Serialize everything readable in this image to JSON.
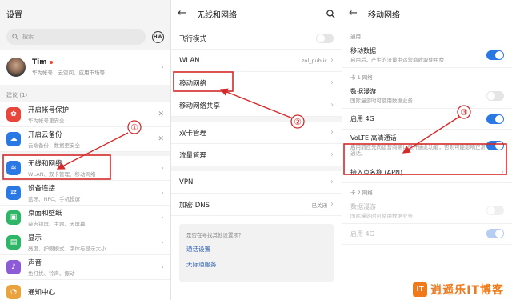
{
  "left": {
    "title": "设置",
    "search_placeholder": "搜索",
    "brand_icon": "HW",
    "account": {
      "name": "Tim",
      "sub": "华为帐号、云空间、应用市场等"
    },
    "suggest_label": "建议 (1)",
    "suggestions": [
      {
        "title": "开启帐号保护",
        "sub": "华为帐号更安全",
        "icon": "account-protect-icon",
        "color": "#e8453c"
      },
      {
        "title": "开启云备份",
        "sub": "云端备份，数据更安全",
        "icon": "cloud-backup-icon",
        "color": "#2a78e4"
      }
    ],
    "items": [
      {
        "title": "无线和网络",
        "sub": "WLAN、双卡管理、移动网络",
        "icon": "wifi-icon",
        "color": "#2a78e4"
      },
      {
        "title": "设备连接",
        "sub": "蓝牙、NFC、手机投屏",
        "icon": "device-link-icon",
        "color": "#2a78e4"
      },
      {
        "title": "桌面和壁纸",
        "sub": "杂志锁屏、主题、天屏幕",
        "icon": "wallpaper-icon",
        "color": "#2fb566"
      },
      {
        "title": "显示",
        "sub": "亮度、护眼模式、字体与显示大小",
        "icon": "display-icon",
        "color": "#2fb566"
      },
      {
        "title": "声音",
        "sub": "免打扰、铃声、振动",
        "icon": "sound-icon",
        "color": "#8e5bd6"
      },
      {
        "title": "通知中心",
        "sub": "",
        "icon": "notify-icon",
        "color": "#e8a33c"
      }
    ]
  },
  "middle": {
    "title": "无线和网络",
    "rows": [
      {
        "label": "飞行模式",
        "value": "",
        "control": "toggle-off"
      },
      {
        "label": "WLAN",
        "value": "zol_public",
        "control": "chevron"
      },
      {
        "label": "移动网络",
        "value": "",
        "control": "chevron"
      },
      {
        "label": "移动网络共享",
        "value": "",
        "control": "chevron"
      },
      {
        "label": "双卡管理",
        "value": "",
        "control": "chevron"
      },
      {
        "label": "流量管理",
        "value": "",
        "control": "chevron"
      },
      {
        "label": "VPN",
        "value": "",
        "control": "chevron"
      },
      {
        "label": "加密 DNS",
        "value": "已关闭",
        "control": "chevron"
      }
    ],
    "suggest_q": "是否在寻找其他设置项？",
    "links": [
      "通话设置",
      "天际通服务"
    ]
  },
  "right": {
    "title": "移动网络",
    "group_general": "通用",
    "mobile_data": {
      "title": "移动数据",
      "sub": "启用后，产生的流量由运营商收取使用费"
    },
    "group_sim1": "卡 1 网络",
    "roaming": {
      "title": "数据漫游",
      "sub": "国际漫游时可使用数据业务"
    },
    "lte4g": {
      "title": "启用 4G"
    },
    "volte": {
      "title": "VoLTE 高清通话",
      "sub": "启用前应先向运营商确认已开通此功能，否则可能影响正常通话。"
    },
    "apn": {
      "title": "接入点名称 (APN)"
    },
    "group_sim2": "卡 2 网络",
    "roaming2": {
      "title": "数据漫游",
      "sub": "国际漫游时可使用数据业务"
    },
    "lte4g2": {
      "title": "启用 4G"
    }
  },
  "annotations": {
    "n1": "①",
    "n2": "②",
    "n3": "③",
    "color": "#d42a2a"
  },
  "watermark": {
    "logo": "IT",
    "text": "逍遥乐IT博客",
    "color": "#f07a1a"
  }
}
